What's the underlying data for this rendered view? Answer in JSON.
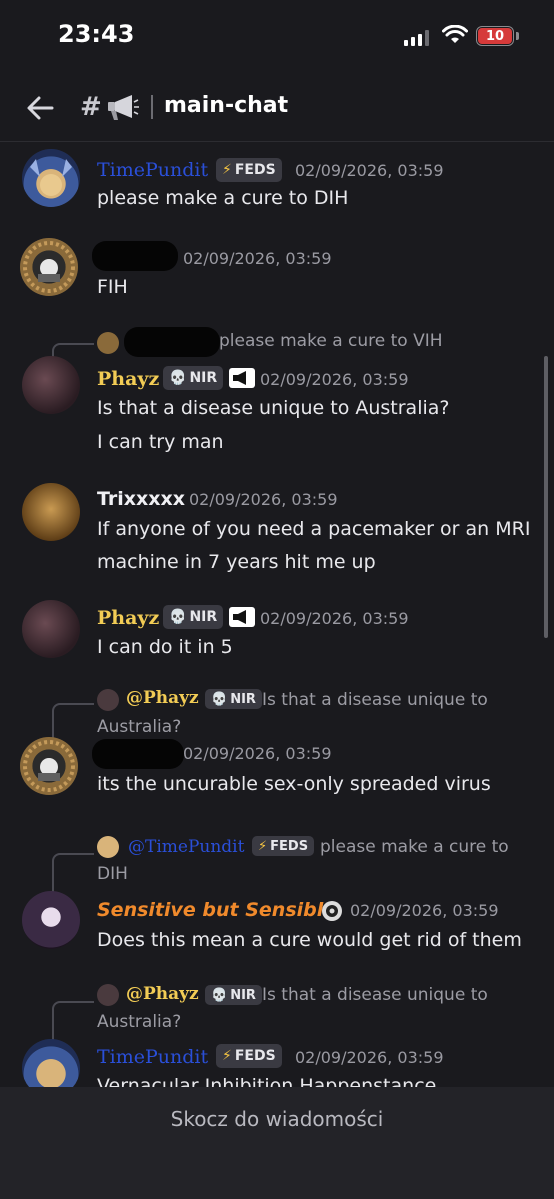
{
  "status_bar": {
    "time": "23:43",
    "battery": "10",
    "battery_color": "#d63a3a"
  },
  "header": {
    "hash": "#",
    "channel_name": "main-chat",
    "channel_icon": "megaphone-icon"
  },
  "messages": [
    {
      "author": "TimePundit",
      "tag": "FEDS",
      "tag_icon": "⚡",
      "timestamp": "02/09/2026, 03:59",
      "lines": [
        "please make a cure to DIH"
      ]
    },
    {
      "author": "",
      "author_redacted": true,
      "timestamp": "02/09/2026, 03:59",
      "lines": [
        "FIH"
      ]
    },
    {
      "reply_to": {
        "author_redacted": true,
        "text": "please make a cure to VIH"
      },
      "author": "Phayz",
      "tag": "NIR",
      "tag_icon": "💀",
      "timestamp": "02/09/2026, 03:59",
      "lines": [
        "Is that a disease unique to Australia?",
        "I can try man"
      ]
    },
    {
      "author": "Trixxxxx",
      "timestamp": "02/09/2026, 03:59",
      "lines": [
        "If anyone of you need a pacemaker or an MRI",
        "machine in 7 years hit me up"
      ]
    },
    {
      "author": "Phayz",
      "tag": "NIR",
      "tag_icon": "💀",
      "timestamp": "02/09/2026, 03:59",
      "lines": [
        "I can do it in 5"
      ]
    },
    {
      "reply_to": {
        "author": "@Phayz",
        "tag": "NIR",
        "tag_icon": "💀",
        "text_line1": "Is that a disease unique to",
        "text_line2": "Australia?"
      },
      "author": "",
      "author_redacted": true,
      "timestamp": "02/09/2026, 03:59",
      "lines": [
        "its the uncurable sex-only spreaded virus"
      ]
    },
    {
      "reply_to": {
        "author": "@TimePundit",
        "tag": "FEDS",
        "tag_icon": "⚡",
        "text_line1": "please make a cure to",
        "text_line2": "DIH"
      },
      "author": "Sensitive but Sensible",
      "timestamp": "02/09/2026, 03:59",
      "lines": [
        "Does this mean a cure would get rid of them"
      ]
    },
    {
      "reply_to": {
        "author": "@Phayz",
        "tag": "NIR",
        "tag_icon": "💀",
        "text_line1": "Is that a disease unique to",
        "text_line2": "Australia?"
      },
      "author": "TimePundit",
      "tag": "FEDS",
      "tag_icon": "⚡",
      "timestamp": "02/09/2026, 03:59",
      "lines": [
        "Vernacular Inhibition Happenstance"
      ]
    }
  ],
  "footer": {
    "jump_label": "Skocz do wiadomości"
  }
}
